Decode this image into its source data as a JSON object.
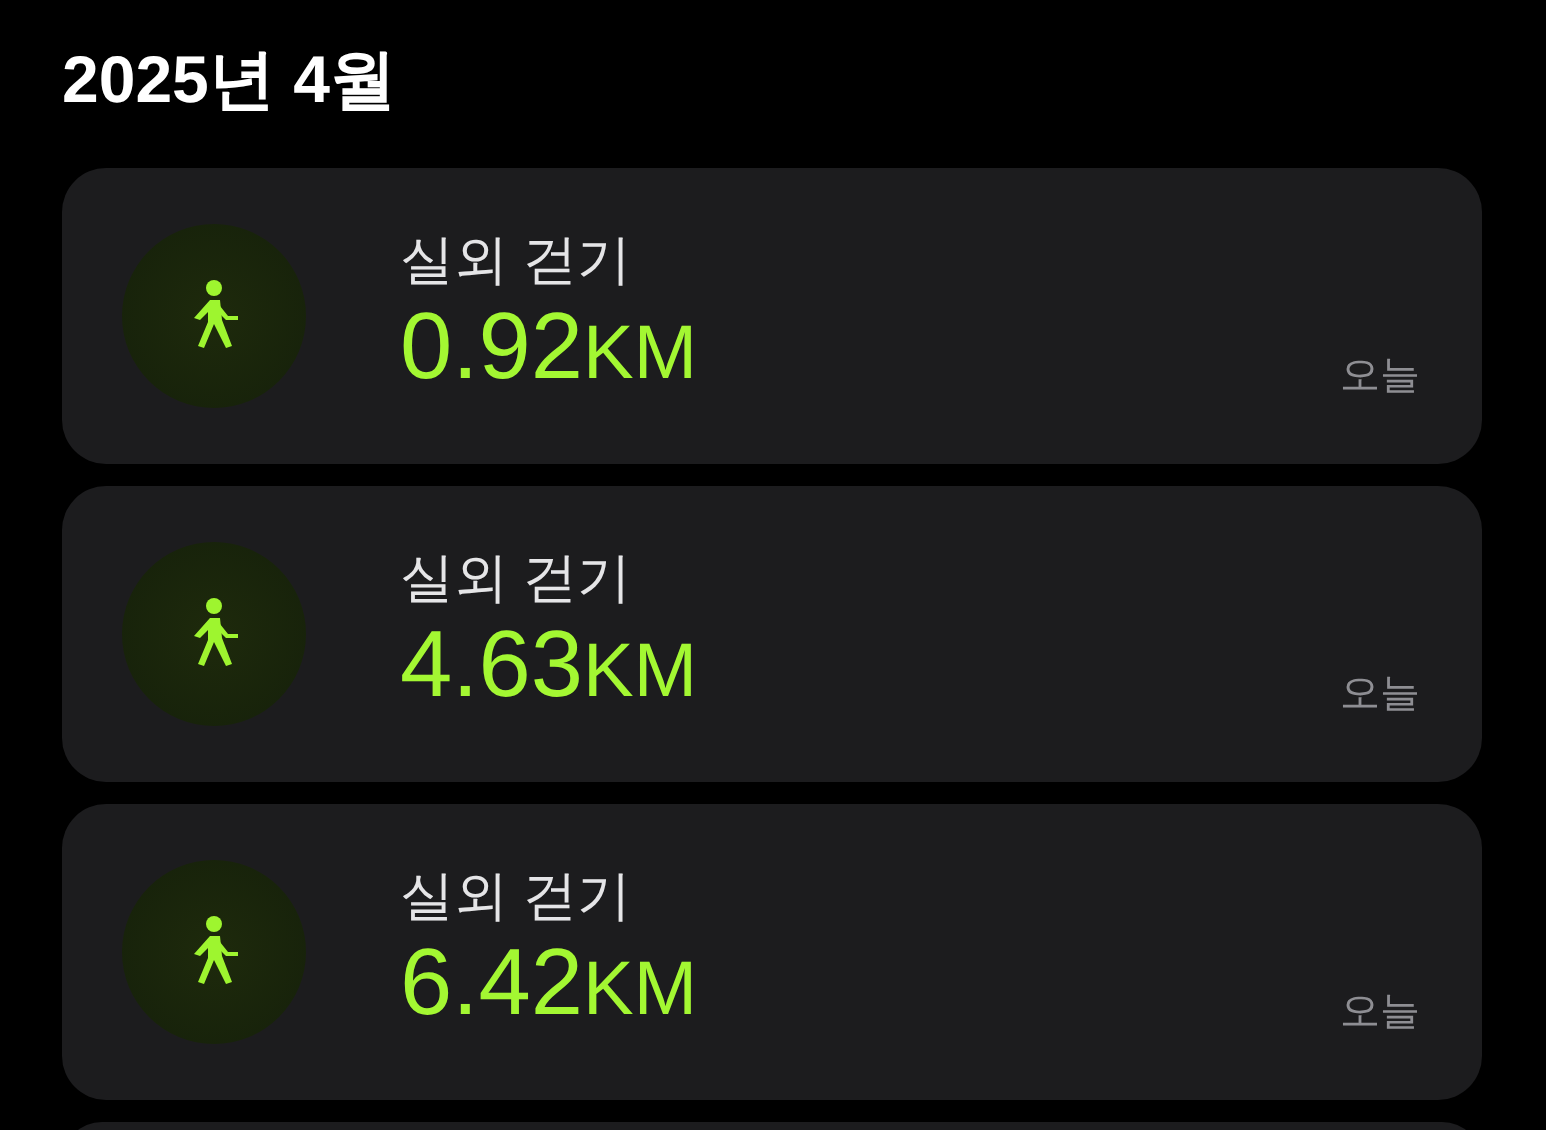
{
  "title": "2025년 4월",
  "workouts": [
    {
      "name": "실외 걷기",
      "distance": "0.92",
      "unit": "KM",
      "date": "오늘"
    },
    {
      "name": "실외 걷기",
      "distance": "4.63",
      "unit": "KM",
      "date": "오늘"
    },
    {
      "name": "실외 걷기",
      "distance": "6.42",
      "unit": "KM",
      "date": "오늘"
    }
  ]
}
